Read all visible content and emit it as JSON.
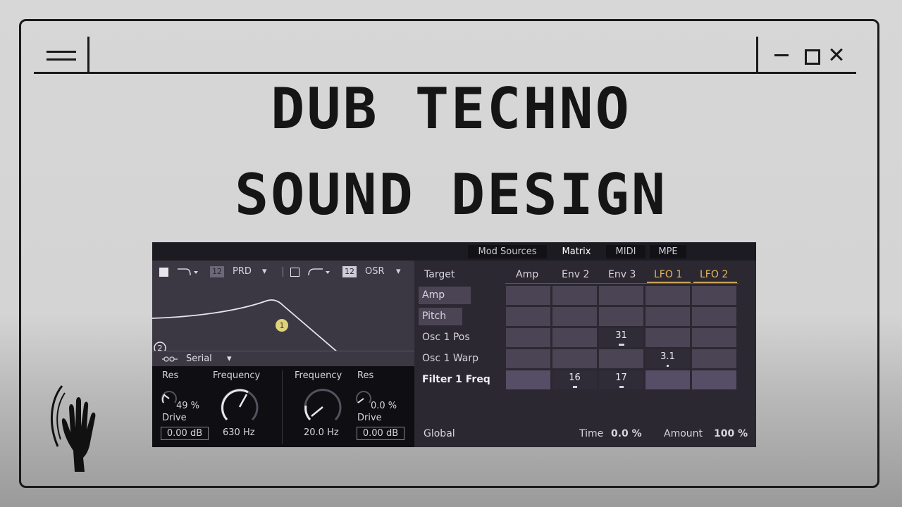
{
  "window": {
    "controls": {
      "minimize": "minimize-icon",
      "maximize": "maximize-icon",
      "close": "close-icon"
    }
  },
  "headline": {
    "line1": "DUB TECHNO",
    "line2": "SOUND DESIGN"
  },
  "synth": {
    "tabs": [
      {
        "label": "Mod Sources",
        "active": false
      },
      {
        "label": "Matrix",
        "active": true
      },
      {
        "label": "MIDI",
        "active": false
      },
      {
        "label": "MPE",
        "active": false
      }
    ],
    "filter": {
      "filter1": {
        "slope": "12",
        "type": "PRD"
      },
      "filter2": {
        "slope": "12",
        "type": "OSR"
      },
      "node1": "1",
      "node2": "2",
      "routing": "Serial",
      "left": {
        "res_label": "Res",
        "res_value": "49 %",
        "drive_label": "Drive",
        "drive_value": "0.00 dB",
        "freq_label": "Frequency",
        "freq_value": "630 Hz"
      },
      "right": {
        "freq_label": "Frequency",
        "freq_value": "20.0 Hz",
        "res_label": "Res",
        "res_value": "0.0 %",
        "drive_label": "Drive",
        "drive_value": "0.00 dB"
      }
    },
    "matrix": {
      "target_label": "Target",
      "columns": [
        "Amp",
        "Env 2",
        "Env 3",
        "LFO 1",
        "LFO 2"
      ],
      "rows": [
        {
          "label": "Amp",
          "values": [
            "",
            "",
            "",
            "",
            ""
          ]
        },
        {
          "label": "Pitch",
          "values": [
            "",
            "",
            "",
            "",
            ""
          ]
        },
        {
          "label": "Osc 1 Pos",
          "values": [
            "",
            "",
            "31",
            "",
            ""
          ]
        },
        {
          "label": "Osc 1 Warp",
          "values": [
            "",
            "",
            "",
            "3.1",
            ""
          ]
        },
        {
          "label": "Filter 1 Freq",
          "values": [
            "",
            "16",
            "17",
            "",
            ""
          ]
        }
      ],
      "global_label": "Global",
      "time_label": "Time",
      "time_value": "0.0 %",
      "amount_label": "Amount",
      "amount_value": "100 %"
    },
    "colors": {
      "lfo_header": "#e6b95a",
      "panel": "#2a2730",
      "cell": "#4a4454"
    }
  }
}
